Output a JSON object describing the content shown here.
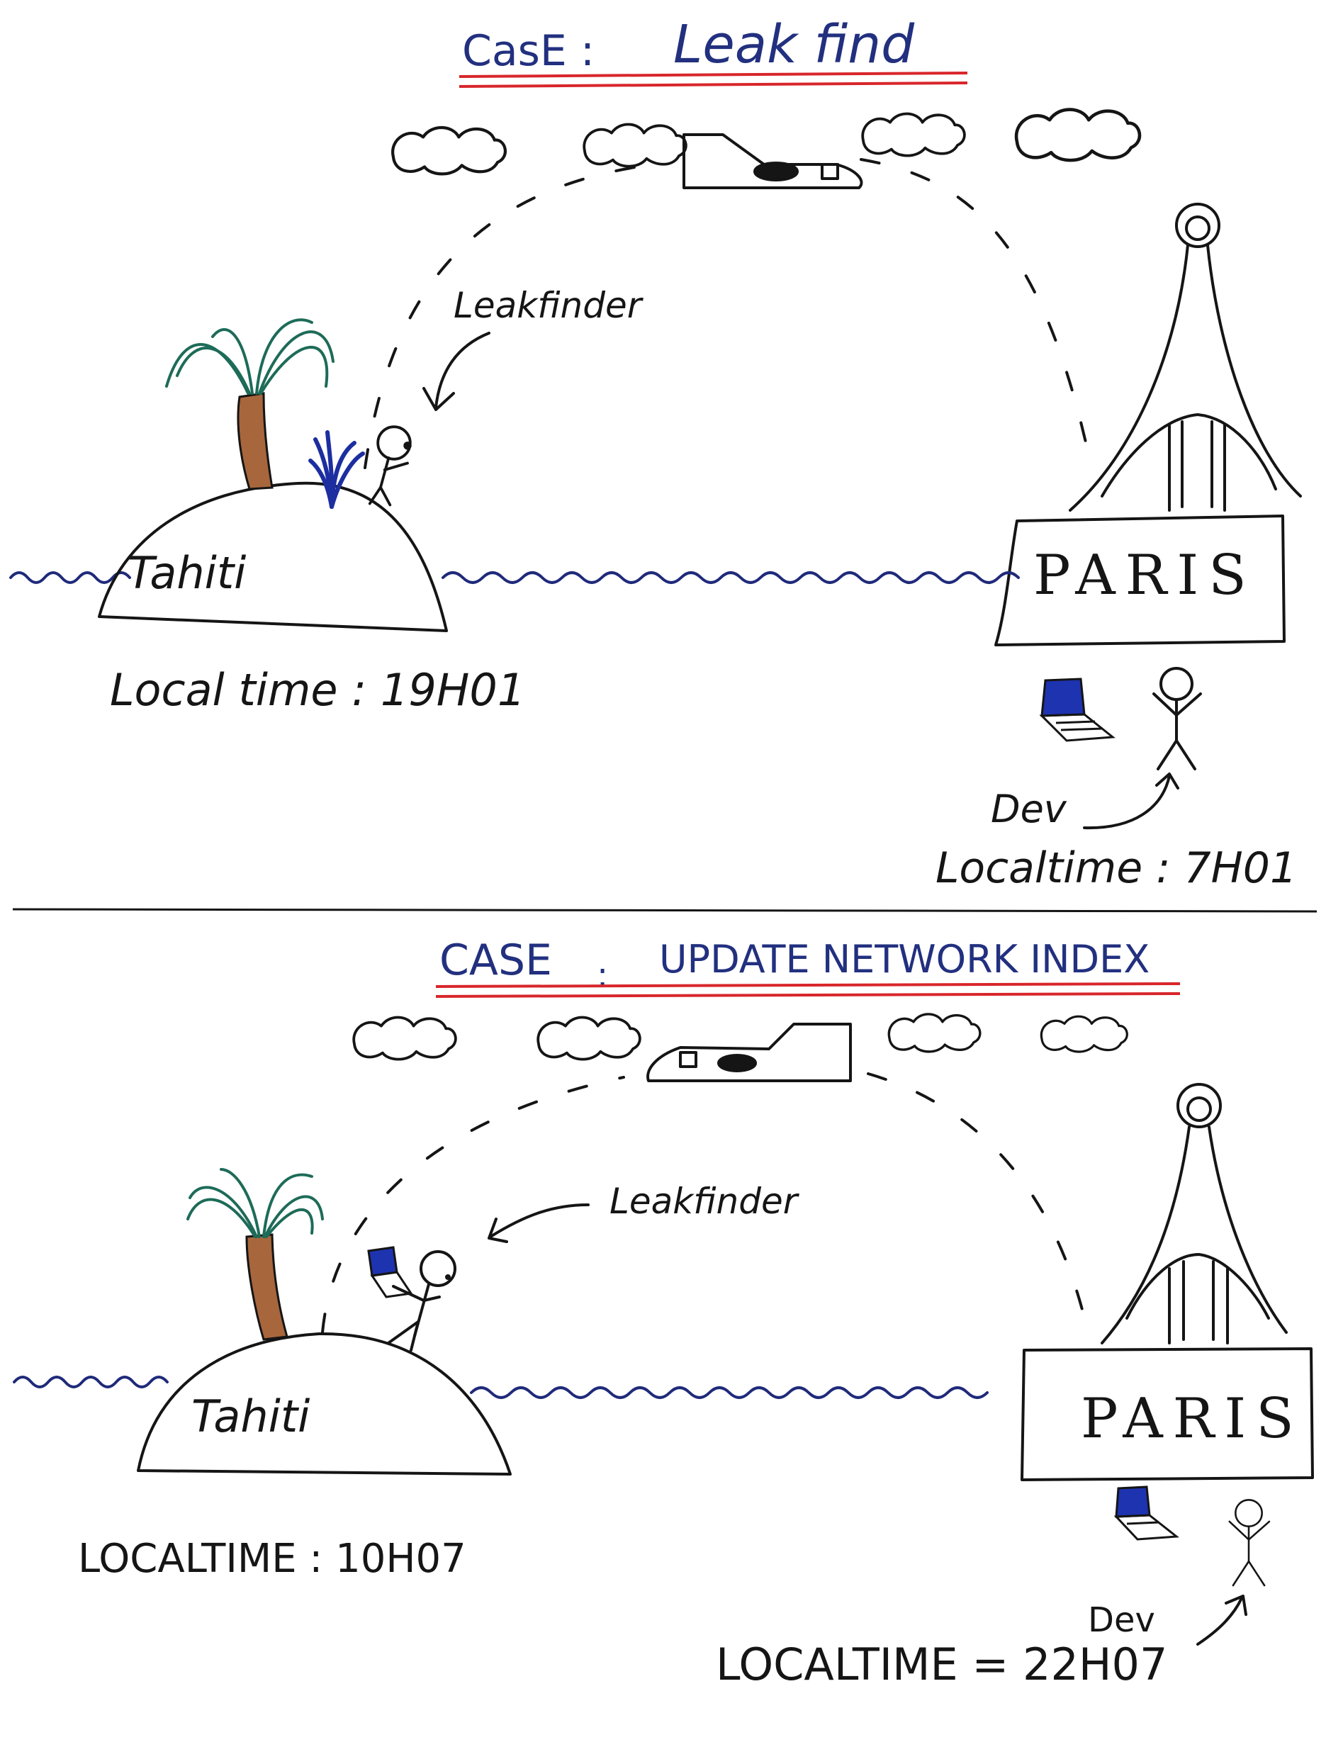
{
  "colors": {
    "ink": "#151515",
    "title_blue": "#22307f",
    "underline_red": "#d8262b",
    "water_blue": "#1f2a7a",
    "palm_green": "#1d6b58",
    "trunk_brown": "#a8663c",
    "laptop_blue": "#1e33b0",
    "splash_blue": "#1c2ea0"
  },
  "icons": [
    "cloud-icon",
    "airplane-icon",
    "palm-tree-icon",
    "stick-figure-icon",
    "laptop-icon",
    "eiffel-tower-icon",
    "water-leak-icon"
  ],
  "case1": {
    "title_prefix": "CasE :",
    "title_name": "Leak find",
    "leakfinder_label": "Leakfinder",
    "island_label": "Tahiti",
    "city_label": "PARIS",
    "tahiti_time": "Local time : 19H01",
    "dev_label": "Dev",
    "paris_time": "Localtime : 7H01"
  },
  "case2": {
    "title_prefix": "CASE",
    "title_sep": ":",
    "title_name": "UPDATE NETWORK INDEX",
    "leakfinder_label": "Leakfinder",
    "island_label": "Tahiti",
    "city_label": "PARIS",
    "tahiti_time": "LOCALTIME : 10H07",
    "dev_label": "Dev",
    "paris_time": "LOCALTIME = 22H07"
  }
}
